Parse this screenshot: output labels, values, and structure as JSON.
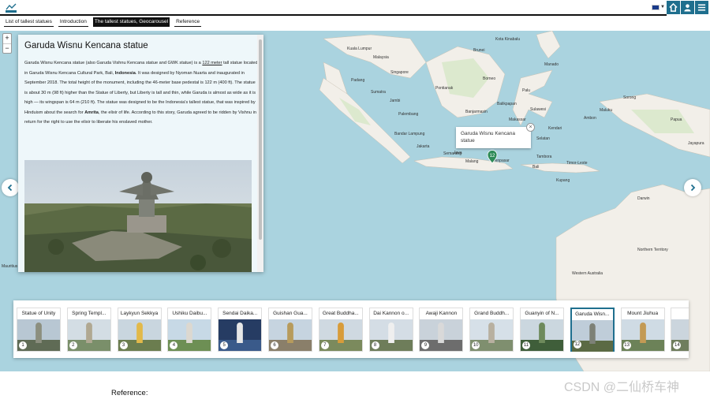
{
  "header": {
    "logo_text": "arcgis",
    "tabs": [
      {
        "label": "List of tallest statues",
        "active": false
      },
      {
        "label": "Introduction",
        "active": false
      },
      {
        "label": "The tallest statues, Geocarousel",
        "active": true
      },
      {
        "label": "Reference",
        "active": false
      }
    ],
    "icons": [
      "flag-uk-icon",
      "home-icon",
      "user-icon",
      "menu-icon"
    ],
    "accent_color": "#1f6f8e"
  },
  "map": {
    "zoom_in": "+",
    "zoom_out": "−",
    "labels": [
      "Malaysia",
      "Brunei",
      "Borneo",
      "Sumatra",
      "Sulawesi",
      "Maluku",
      "Papua",
      "Java",
      "Jakarta",
      "Bandar Lampung",
      "Semarang",
      "Malang",
      "Bali",
      "Denpasar",
      "Kupang",
      "Darwin",
      "Timor-Leste",
      "Kendari",
      "Manado",
      "Pontianak",
      "Makassar",
      "Palembang",
      "Singapore",
      "Kuala Lumpur",
      "Jambi",
      "Padang",
      "Jayapura",
      "Sorong",
      "Ambon",
      "Balikpapan",
      "Palu",
      "Kota Kinabalu",
      "Tambora",
      "Banjarmasin",
      "Selatan",
      "Western Australia",
      "Northern Territory",
      "Mauritius"
    ],
    "popup": {
      "text": "Garuda Wisnu Kencana statue",
      "close": "×"
    },
    "marker_number": "12",
    "ocean_color": "#aad3df",
    "land_color": "#f2efe9"
  },
  "story": {
    "title": "Garuda Wisnu Kencana statue",
    "p1": "Garuda Wisnu Kencana statue (also Garuda Vishnu Kencana statue and GWK statue) is a ",
    "link1": "122 meter",
    "p2": " tall statue located in Garuda Wisnu Kencana Cultural Park, Bali, ",
    "bold1": "Indonesia",
    "p3": ". It was designed by Nyoman Nuarta and inaugurated in September 2018. The total height of the monument, including the 46-meter base pedestal is 122 m (400 ft). The statue is about 30 m (98 ft) higher than the Statue of Liberty, but Liberty is tall and thin, while Garuda is almost as wide as it is high — its wingspan is 64 m (210 ft). The statue was designed to be the Indonesia's tallest statue, that was inspired by Hinduism about the search for ",
    "bold2": "Amrita",
    "p4": ", the elixir of life. According to this story, Garuda agreed to be ridden by Vishnu in return for the right to use the elixir to liberate his enslaved mother."
  },
  "carousel": {
    "cards": [
      {
        "label": "Statue of Unity",
        "num": "1",
        "selected": false
      },
      {
        "label": "Spring Templ...",
        "num": "2",
        "selected": false
      },
      {
        "label": "Laykyun Sekkya",
        "num": "3",
        "selected": false
      },
      {
        "label": "Ushiku Daibu...",
        "num": "4",
        "selected": false
      },
      {
        "label": "Sendai Daika...",
        "num": "5",
        "selected": false
      },
      {
        "label": "Guishan Gua...",
        "num": "6",
        "selected": false
      },
      {
        "label": "Great Buddha...",
        "num": "7",
        "selected": false
      },
      {
        "label": "Dai Kannon o...",
        "num": "8",
        "selected": false
      },
      {
        "label": "Awaji Kannon",
        "num": "9",
        "selected": false
      },
      {
        "label": "Grand Buddh...",
        "num": "10",
        "selected": false
      },
      {
        "label": "Guanyin of N...",
        "num": "11",
        "selected": false
      },
      {
        "label": "Garuda Wisn...",
        "num": "12",
        "selected": true
      },
      {
        "label": "Mount Jiuhua",
        "num": "13",
        "selected": false
      },
      {
        "label": "T...",
        "num": "14",
        "selected": false
      }
    ],
    "next": "›"
  },
  "footer": {
    "reference_label": "Reference:",
    "watermark": "CSDN @二仙桥车神"
  }
}
